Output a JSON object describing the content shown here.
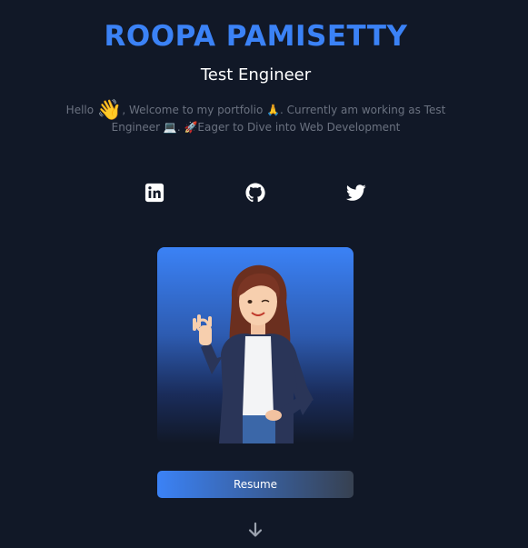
{
  "hero": {
    "name": "ROOPA PAMISETTY",
    "role": "Test Engineer",
    "intro_1": "Hello ",
    "wave_emoji": "👋",
    "intro_2": ", Welcome to my portfolio 🙏. Currently am working as Test Engineer 💻. 🚀Eager to Dive into Web Development"
  },
  "socials": [
    {
      "icon": "linkedin-icon"
    },
    {
      "icon": "github-icon"
    },
    {
      "icon": "twitter-icon"
    }
  ],
  "resume_button": {
    "label": "Resume"
  },
  "colors": {
    "background": "#111827",
    "accent": "#3b82f6",
    "muted_text": "#6b7280"
  }
}
